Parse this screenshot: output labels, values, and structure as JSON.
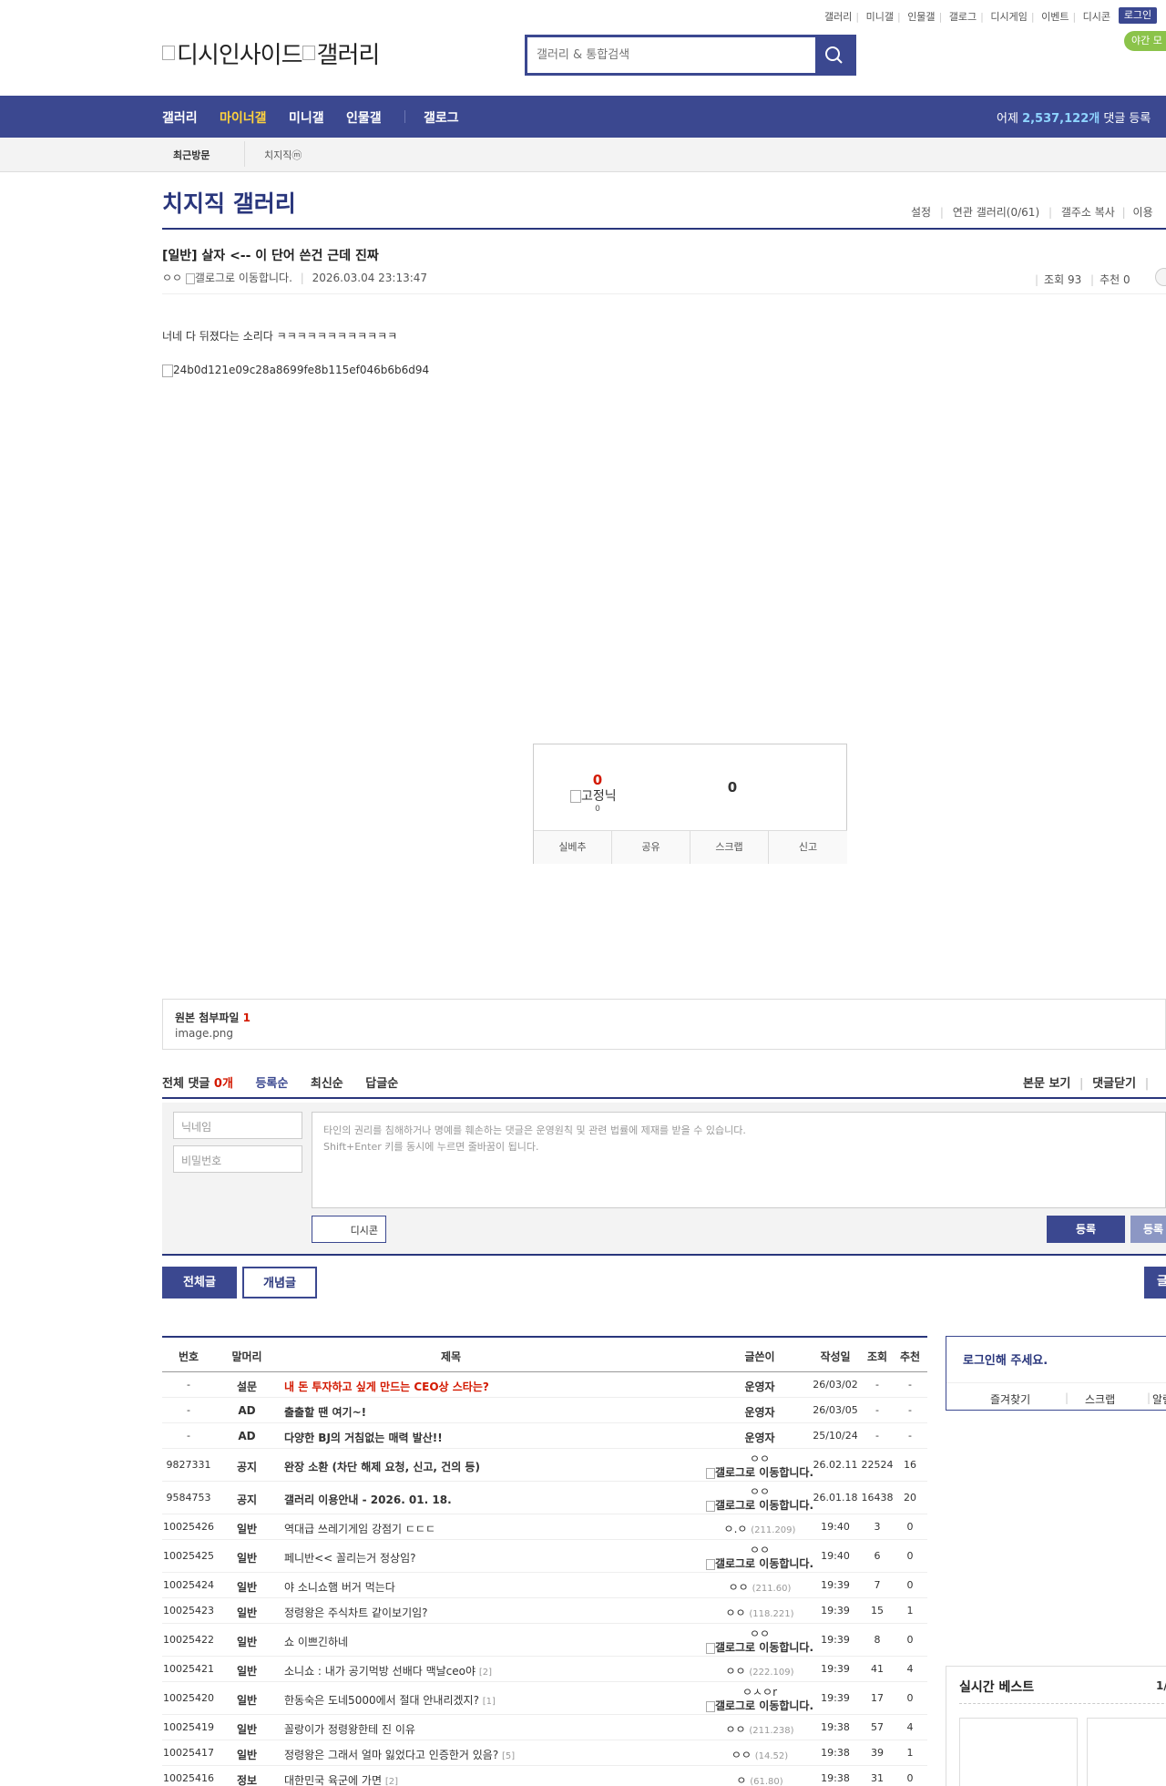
{
  "header": {
    "top_links": [
      "갤러리",
      "미니갤",
      "인물갤",
      "갤로그",
      "디시게임",
      "이벤트",
      "디시콘"
    ],
    "login_label": "로그인",
    "night_mode_label": "야간 모",
    "logo_alt": "디시인사이드",
    "logo_alt_2": "갤러리",
    "search_placeholder": "갤러리 & 통합검색"
  },
  "nav": {
    "items": [
      "갤러리",
      "마이너갤",
      "미니갤",
      "인물갤",
      "갤로그"
    ],
    "yesterday_prefix": "어제",
    "yesterday_count": "2,537,122개",
    "yesterday_suffix": "댓글 등록"
  },
  "visit": {
    "label": "최근방문",
    "gallery": "치지직ⓜ"
  },
  "gallery": {
    "title": "치지직 갤러리",
    "tools": [
      "설정",
      "연관 갤러리(0/61)",
      "갤주소 복사",
      "이용"
    ]
  },
  "post": {
    "title": "[일반] 살자 <-- 이 단어 쓴건 근데 진짜",
    "writer": "ㅇㅇ",
    "gallog_alt": "갤로그로 이동합니다.",
    "date": "2026.03.04 23:13:47",
    "views_label": "조회 93",
    "recommend_label": "추천 0",
    "body": "너네 다 뒤졌다는 소리다 ㅋㅋㅋㅋㅋㅋㅋㅋㅋㅋㅋㅋ",
    "image_alt": "24b0d121e09c28a8699fe8b115ef046b6b6d94"
  },
  "recommend": {
    "up_count": "0",
    "fixed_alt": "고정닉",
    "fixed_count": "0",
    "down_count": "0",
    "buttons": [
      "실베추",
      "공유",
      "스크랩",
      "신고"
    ]
  },
  "attachment": {
    "label": "원본 첨부파일",
    "count": "1",
    "filename": "image.png"
  },
  "comments": {
    "total_label": "전체 댓글",
    "total_count": "0개",
    "sort": [
      "등록순",
      "최신순",
      "답글순"
    ],
    "right": [
      "본문 보기",
      "댓글닫기"
    ],
    "nick_placeholder": "닉네임",
    "pw_placeholder": "비밀번호",
    "notice_line1": "타인의 권리를 침해하거나 명예를 훼손하는 댓글은 운영원칙 및 관련 법률에 제재를 받을 수 있습니다.",
    "notice_line2": "Shift+Enter 키를 동시에 누르면 줄바꿈이 됩니다.",
    "dccon_label": "디시콘",
    "register_label": "등록",
    "register2_label": "등록"
  },
  "list_buttons": [
    "전체글",
    "개념글",
    "글"
  ],
  "table": {
    "headers": [
      "번호",
      "말머리",
      "제목",
      "글쓴이",
      "작성일",
      "조회",
      "추천"
    ],
    "rows": [
      {
        "num": "-",
        "head": "설문",
        "title": "내 돈 투자하고 싶게 만드는 CEO상 스타는?",
        "writer": "운영자",
        "ip": "",
        "date": "26/03/02",
        "views": "-",
        "rec": "-",
        "style": "red",
        "writer_bold": true,
        "twoline": false,
        "count": ""
      },
      {
        "num": "-",
        "head": "AD",
        "title": "출출할 땐 여기~!",
        "writer": "운영자",
        "ip": "",
        "date": "26/03/05",
        "views": "-",
        "rec": "-",
        "style": "bold",
        "writer_bold": true,
        "twoline": false,
        "count": ""
      },
      {
        "num": "-",
        "head": "AD",
        "title": "다양한 BJ의 거침없는 매력 발산!!",
        "writer": "운영자",
        "ip": "",
        "date": "25/10/24",
        "views": "-",
        "rec": "-",
        "style": "bold",
        "writer_bold": true,
        "twoline": false,
        "count": ""
      },
      {
        "num": "9827331",
        "head": "공지",
        "title": "완장 소환 (차단 해제 요청, 신고, 건의 등)",
        "writer": "ㅇㅇ",
        "ip": "갤로그로 이동합니다.",
        "date": "26.02.11",
        "views": "22524",
        "rec": "16",
        "style": "bold",
        "writer_bold": true,
        "twoline": true,
        "count": ""
      },
      {
        "num": "9584753",
        "head": "공지",
        "title": "갤러리 이용안내 - 2026. 01. 18.",
        "writer": "ㅇㅇ",
        "ip": "갤로그로 이동합니다.",
        "date": "26.01.18",
        "views": "16438",
        "rec": "20",
        "style": "bold",
        "writer_bold": true,
        "twoline": true,
        "count": ""
      },
      {
        "num": "10025426",
        "head": "일반",
        "title": "역대급 쓰레기게임 강점기 ㄷㄷㄷ",
        "writer": "ㅇ.ㅇ",
        "ip": "(211.209)",
        "date": "19:40",
        "views": "3",
        "rec": "0",
        "style": "",
        "writer_bold": false,
        "twoline": false,
        "count": ""
      },
      {
        "num": "10025425",
        "head": "일반",
        "title": "페니반<< 꼴리는거 정상임?",
        "writer": "ㅇㅇ",
        "ip": "갤로그로 이동합니다.",
        "date": "19:40",
        "views": "6",
        "rec": "0",
        "style": "",
        "writer_bold": false,
        "twoline": true,
        "count": ""
      },
      {
        "num": "10025424",
        "head": "일반",
        "title": "야 소니쇼햄 버거 먹는다",
        "writer": "ㅇㅇ",
        "ip": "(211.60)",
        "date": "19:39",
        "views": "7",
        "rec": "0",
        "style": "",
        "writer_bold": false,
        "twoline": false,
        "count": ""
      },
      {
        "num": "10025423",
        "head": "일반",
        "title": "정령왕은 주식차트 같이보기임?",
        "writer": "ㅇㅇ",
        "ip": "(118.221)",
        "date": "19:39",
        "views": "15",
        "rec": "1",
        "style": "",
        "writer_bold": false,
        "twoline": false,
        "count": ""
      },
      {
        "num": "10025422",
        "head": "일반",
        "title": "쇼 이쁘긴하네",
        "writer": "ㅇㅇ",
        "ip": "갤로그로 이동합니다.",
        "date": "19:39",
        "views": "8",
        "rec": "0",
        "style": "",
        "writer_bold": false,
        "twoline": true,
        "count": ""
      },
      {
        "num": "10025421",
        "head": "일반",
        "title": "소니쇼 : 내가 공기먹방 선배다 맥날ceo야",
        "writer": "ㅇㅇ",
        "ip": "(222.109)",
        "date": "19:39",
        "views": "41",
        "rec": "4",
        "style": "",
        "writer_bold": false,
        "twoline": false,
        "count": "[2]"
      },
      {
        "num": "10025420",
        "head": "일반",
        "title": "한동숙은 도네5000에서 절대 안내리겠지?",
        "writer": "ㅇㅅㅇr",
        "ip": "갤로그로 이동합니다.",
        "date": "19:39",
        "views": "17",
        "rec": "0",
        "style": "",
        "writer_bold": false,
        "twoline": true,
        "count": "[1]"
      },
      {
        "num": "10025419",
        "head": "일반",
        "title": "꼴랑이가 정령왕한테 진 이유",
        "writer": "ㅇㅇ",
        "ip": "(211.238)",
        "date": "19:38",
        "views": "57",
        "rec": "4",
        "style": "",
        "writer_bold": false,
        "twoline": false,
        "count": ""
      },
      {
        "num": "10025417",
        "head": "일반",
        "title": "정령왕은 그래서 얼마 잃었다고 인증한거 있음?",
        "writer": "ㅇㅇ",
        "ip": "(14.52)",
        "date": "19:38",
        "views": "39",
        "rec": "1",
        "style": "",
        "writer_bold": false,
        "twoline": false,
        "count": "[5]"
      },
      {
        "num": "10025416",
        "head": "정보",
        "title": "대한민국 육군에 가면",
        "writer": "ㅇ",
        "ip": "(61.80)",
        "date": "19:38",
        "views": "31",
        "rec": "0",
        "style": "",
        "writer_bold": false,
        "twoline": false,
        "count": "[2]"
      }
    ]
  },
  "sidebar": {
    "login_prompt": "로그인해 주세요.",
    "links": [
      "즐겨찾기",
      "스크랩",
      "알림"
    ],
    "realtime_best": "실시간 베스트",
    "page": "1/"
  }
}
